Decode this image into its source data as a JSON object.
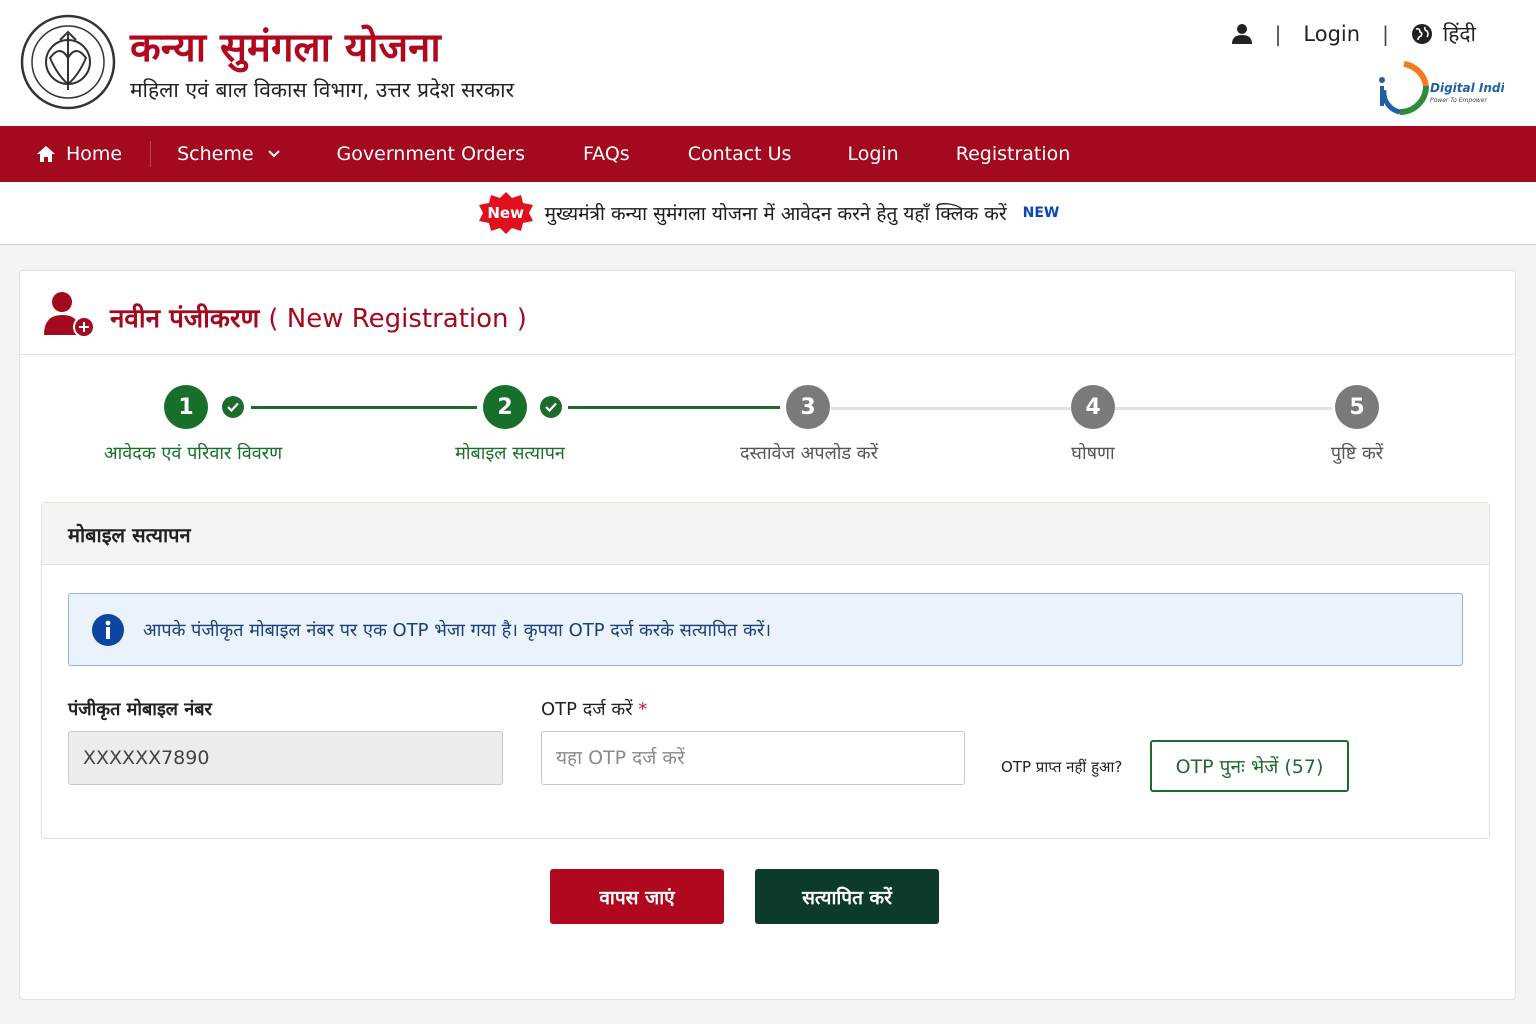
{
  "header": {
    "title": "कन्या सुमंगला योजना",
    "subtitle": "महिला एवं बाल विकास विभाग, उत्तर प्रदेश सरकार",
    "login_label": "Login",
    "language_label": "हिंदी",
    "separator": "|",
    "digital_india": "Digital India",
    "digital_india_tagline": "Power To Empower"
  },
  "nav": {
    "home": "Home",
    "scheme": "Scheme",
    "government_orders": "Government Orders",
    "faqs": "FAQs",
    "contact_us": "Contact Us",
    "login": "Login",
    "registration": "Registration"
  },
  "announcement": {
    "badge": "New",
    "text": "मुख्यमंत्री कन्या सुमंगला योजना में आवेदन करने हेतु यहाँ क्लिक करें",
    "new_tag": "NEW"
  },
  "registration": {
    "title_hi": "नवीन पंजीकरण",
    "title_en": "( New Registration )"
  },
  "steps": [
    {
      "number": "1",
      "label": "आवेदक एवं परिवार विवरण",
      "status": "done"
    },
    {
      "number": "2",
      "label": "मोबाइल सत्यापन",
      "status": "done"
    },
    {
      "number": "3",
      "label": "दस्तावेज अपलोड करें",
      "status": "todo"
    },
    {
      "number": "4",
      "label": "घोषणा",
      "status": "todo"
    },
    {
      "number": "5",
      "label": "पुष्टि करें",
      "status": "todo"
    }
  ],
  "panel": {
    "title": "मोबाइल सत्यापन",
    "info": "आपके पंजीकृत मोबाइल नंबर पर एक OTP भेजा गया है।  कृपया OTP दर्ज करके सत्यापित करें।",
    "mobile_label": "पंजीकृत मोबाइल नंबर",
    "mobile_value": "XXXXXX7890",
    "otp_label": "OTP दर्ज करें",
    "otp_required": "*",
    "otp_placeholder": "यहा OTP दर्ज करें",
    "resend_question": "OTP प्राप्त नहीं हुआ?",
    "resend_button": "OTP पुनः भेजें (57)"
  },
  "actions": {
    "back": "वापस जाएं",
    "verify": "सत्यापित करें"
  },
  "colors": {
    "brand_red": "#a30a20",
    "step_done": "#17702a",
    "step_todo": "#7a7a7a",
    "verify_button": "#0c3b2a"
  }
}
